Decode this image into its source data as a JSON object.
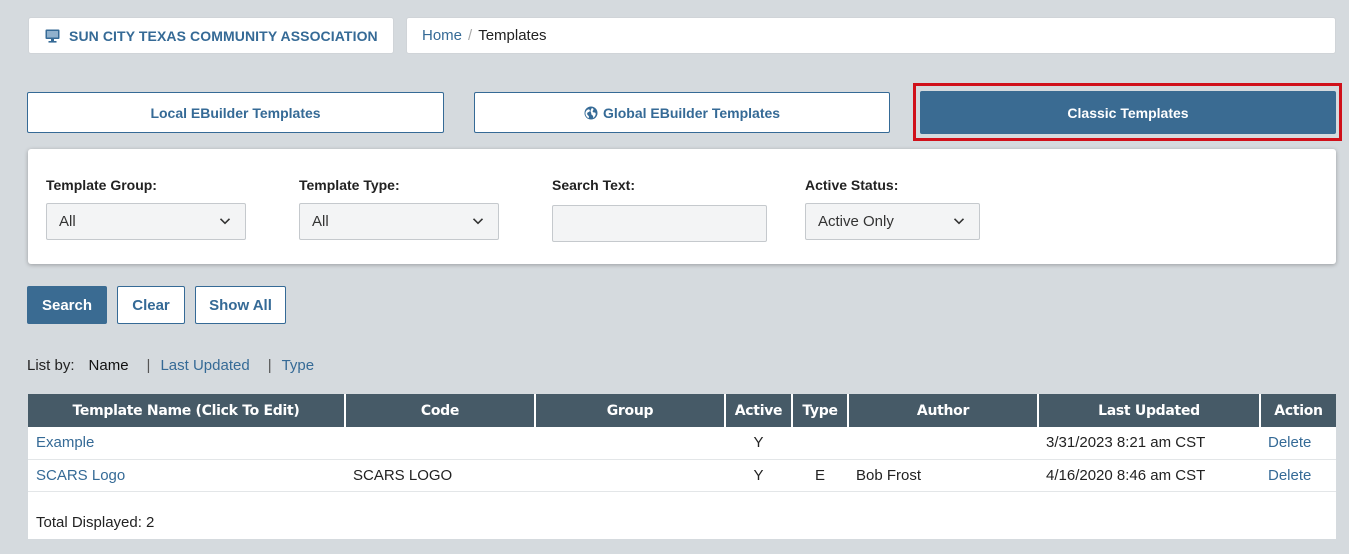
{
  "header": {
    "org_name": "SUN CITY TEXAS COMMUNITY ASSOCIATION",
    "org_icon": "monitor-icon",
    "breadcrumb": {
      "home": "Home",
      "separator": "/",
      "current": "Templates"
    }
  },
  "tabs": {
    "local": "Local EBuilder Templates",
    "global": "Global EBuilder Templates",
    "global_icon": "globe-icon",
    "classic": "Classic Templates",
    "active": "classic"
  },
  "filters": {
    "template_group": {
      "label": "Template Group:",
      "value": "All"
    },
    "template_type": {
      "label": "Template Type:",
      "value": "All"
    },
    "search_text": {
      "label": "Search Text:",
      "value": ""
    },
    "active_status": {
      "label": "Active Status:",
      "value": "Active Only"
    }
  },
  "actions": {
    "search": "Search",
    "clear": "Clear",
    "show_all": "Show All"
  },
  "list_by": {
    "label": "List by:",
    "current": "Name",
    "separator": "|",
    "options": [
      "Last Updated",
      "Type"
    ]
  },
  "table": {
    "columns": [
      "Template Name (Click To Edit)",
      "Code",
      "Group",
      "Active",
      "Type",
      "Author",
      "Last Updated",
      "Action"
    ],
    "rows": [
      {
        "name": "Example",
        "code": "",
        "group": "",
        "active": "Y",
        "type": "",
        "author": "",
        "last_updated": "3/31/2023 8:21 am CST",
        "action": "Delete"
      },
      {
        "name": "SCARS Logo",
        "code": "SCARS LOGO",
        "group": "",
        "active": "Y",
        "type": "E",
        "author": "Bob Frost",
        "last_updated": "4/16/2020 8:46 am CST",
        "action": "Delete"
      }
    ],
    "total_label": "Total Displayed: 2"
  },
  "colors": {
    "accent": "#3a6b92",
    "link": "#356a96",
    "header_bg": "#465a67",
    "highlight": "#d0101a",
    "page_bg": "#d5dade"
  }
}
